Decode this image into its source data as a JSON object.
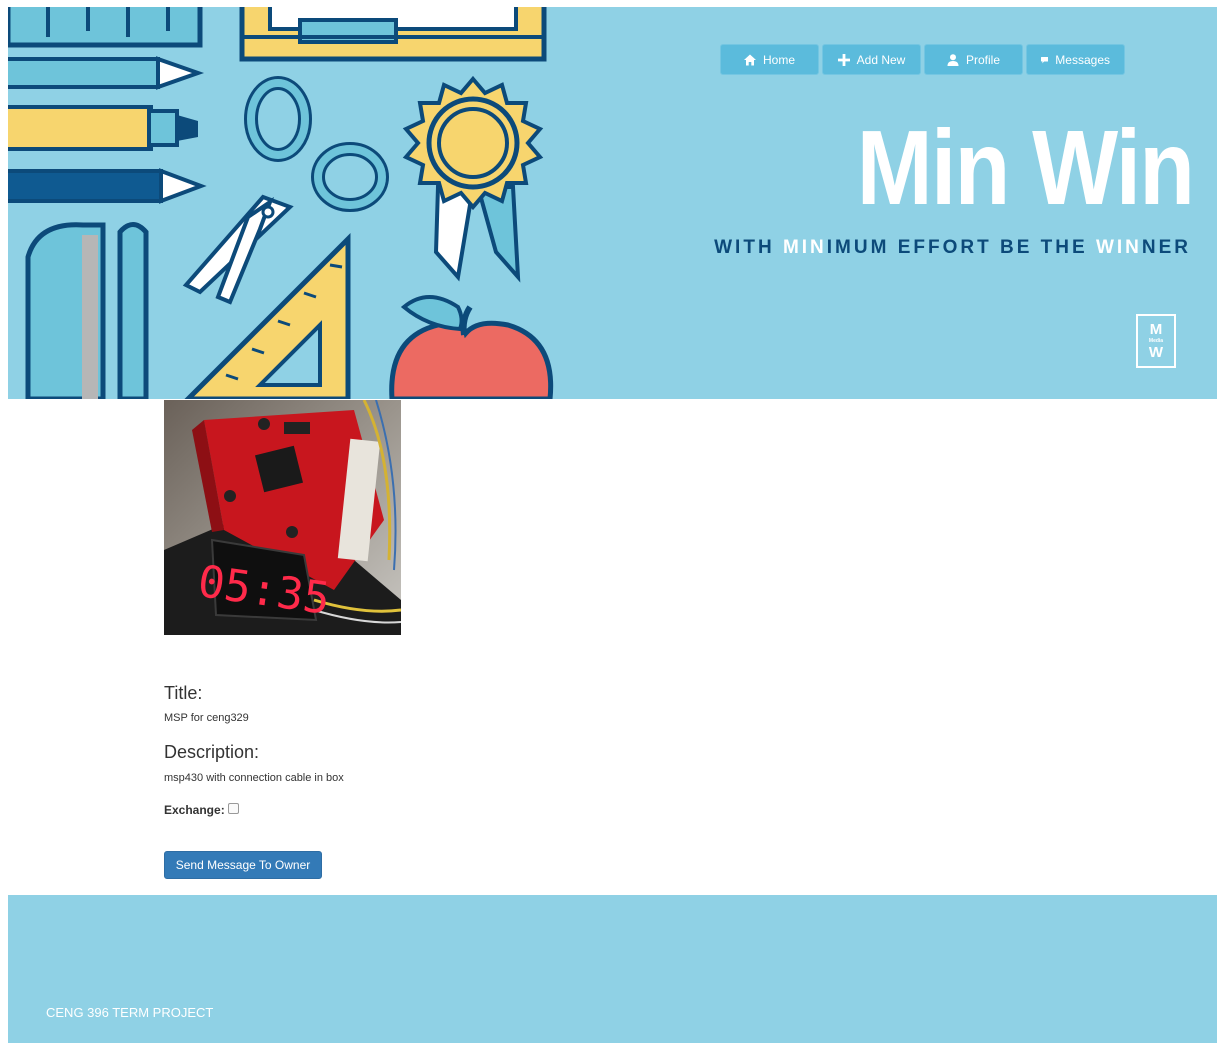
{
  "colors": {
    "banner_bg": "#8fd1e5",
    "nav_button_bg": "#5bbbdc",
    "tagline_dark": "#0c4a7a",
    "primary_button": "#337ab7"
  },
  "nav": {
    "items": [
      {
        "label": "Home",
        "icon": "home-icon"
      },
      {
        "label": "Add New",
        "icon": "plus-icon"
      },
      {
        "label": "Profile",
        "icon": "user-icon"
      },
      {
        "label": "Messages",
        "icon": "chat-bubble-icon"
      }
    ]
  },
  "brand": {
    "name": "Min Win",
    "tagline": {
      "part1": "WITH ",
      "part2": "MIN",
      "part3": "IMUM EFFORT BE THE ",
      "part4": "WIN",
      "part5": "NER"
    },
    "logo": {
      "top": "M",
      "middle": "Media",
      "bottom": "W"
    }
  },
  "product": {
    "display_time": "05:35",
    "title_label": "Title:",
    "title_value": "MSP for ceng329",
    "description_label": "Description:",
    "description_value": "msp430 with connection cable in box",
    "exchange_label": "Exchange:",
    "exchange_checked": false,
    "send_button_label": "Send Message To Owner"
  },
  "footer": {
    "text": "CENG 396 TERM PROJECT"
  }
}
